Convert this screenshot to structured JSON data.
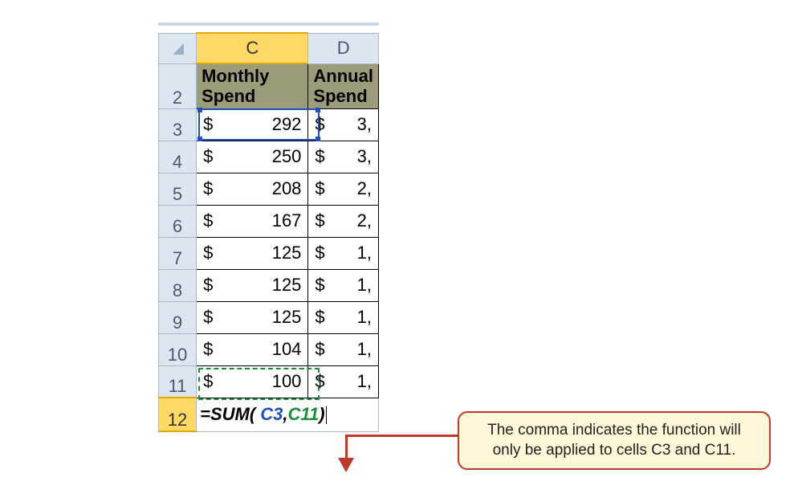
{
  "columns": {
    "c": "C",
    "d": "D"
  },
  "header": {
    "c_line1": "Monthly",
    "c_line2": "Spend",
    "d_line1": "Annual",
    "d_line2": "Spend"
  },
  "rows": [
    {
      "num": "2"
    },
    {
      "num": "3",
      "c_cur": "$",
      "c_val": "292",
      "d_cur": "$",
      "d_val": "3,"
    },
    {
      "num": "4",
      "c_cur": "$",
      "c_val": "250",
      "d_cur": "$",
      "d_val": "3,"
    },
    {
      "num": "5",
      "c_cur": "$",
      "c_val": "208",
      "d_cur": "$",
      "d_val": "2,"
    },
    {
      "num": "6",
      "c_cur": "$",
      "c_val": "167",
      "d_cur": "$",
      "d_val": "2,"
    },
    {
      "num": "7",
      "c_cur": "$",
      "c_val": "125",
      "d_cur": "$",
      "d_val": "1,"
    },
    {
      "num": "8",
      "c_cur": "$",
      "c_val": "125",
      "d_cur": "$",
      "d_val": "1,"
    },
    {
      "num": "9",
      "c_cur": "$",
      "c_val": "125",
      "d_cur": "$",
      "d_val": "1,"
    },
    {
      "num": "10",
      "c_cur": "$",
      "c_val": "104",
      "d_cur": "$",
      "d_val": "1,"
    },
    {
      "num": "11",
      "c_cur": "$",
      "c_val": "100",
      "d_cur": "$",
      "d_val": "1,"
    },
    {
      "num": "12"
    }
  ],
  "formula": {
    "eq": "=",
    "fn": "SUM",
    "open": "(",
    "ref1": " C3",
    "comma": ",",
    "ref2": "C11",
    "close": ")"
  },
  "callout": {
    "line1": "The comma indicates the function will",
    "line2": "only be applied to cells C3 and C11."
  }
}
